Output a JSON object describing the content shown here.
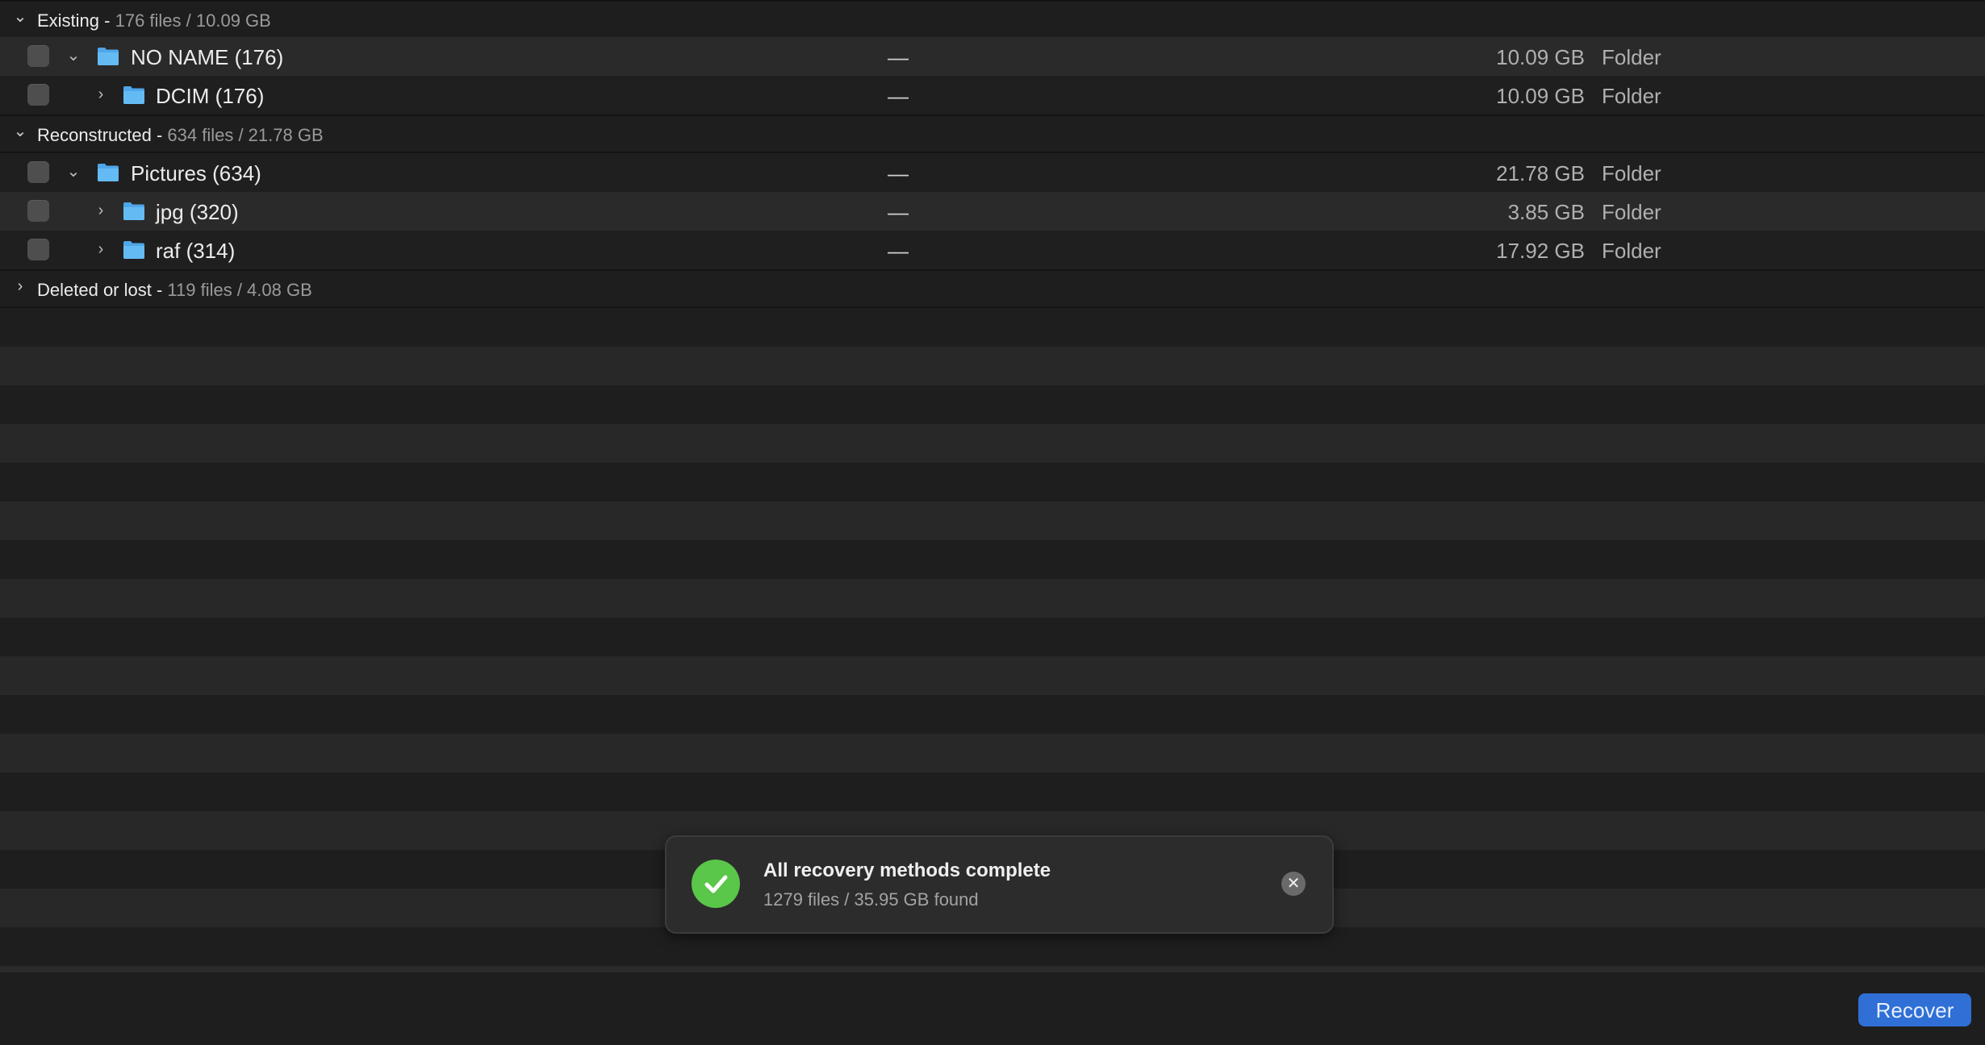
{
  "groups": [
    {
      "name": "Existing - ",
      "stats": "176 files / 10.09 GB",
      "expanded": true
    },
    {
      "name": "Reconstructed - ",
      "stats": "634 files / 21.78 GB",
      "expanded": true
    },
    {
      "name": "Deleted or lost - ",
      "stats": "119 files / 4.08 GB",
      "expanded": false
    }
  ],
  "rows": [
    {
      "name": "NO NAME (176)",
      "date": "—",
      "size": "10.09 GB",
      "kind": "Folder"
    },
    {
      "name": "DCIM (176)",
      "date": "—",
      "size": "10.09 GB",
      "kind": "Folder"
    },
    {
      "name": "Pictures (634)",
      "date": "—",
      "size": "21.78 GB",
      "kind": "Folder"
    },
    {
      "name": "jpg (320)",
      "date": "—",
      "size": "3.85 GB",
      "kind": "Folder"
    },
    {
      "name": "raf (314)",
      "date": "—",
      "size": "17.92 GB",
      "kind": "Folder"
    }
  ],
  "toast": {
    "title": "All recovery methods complete",
    "subtitle": "1279 files / 35.95 GB found",
    "icon": "checkmark-circle-icon",
    "accent": "#5ac64a"
  },
  "footer": {
    "recover_label": "Recover",
    "accent": "#2f6fd6"
  },
  "colors": {
    "folder": "#5db3f0",
    "background": "#1e1e1e"
  }
}
